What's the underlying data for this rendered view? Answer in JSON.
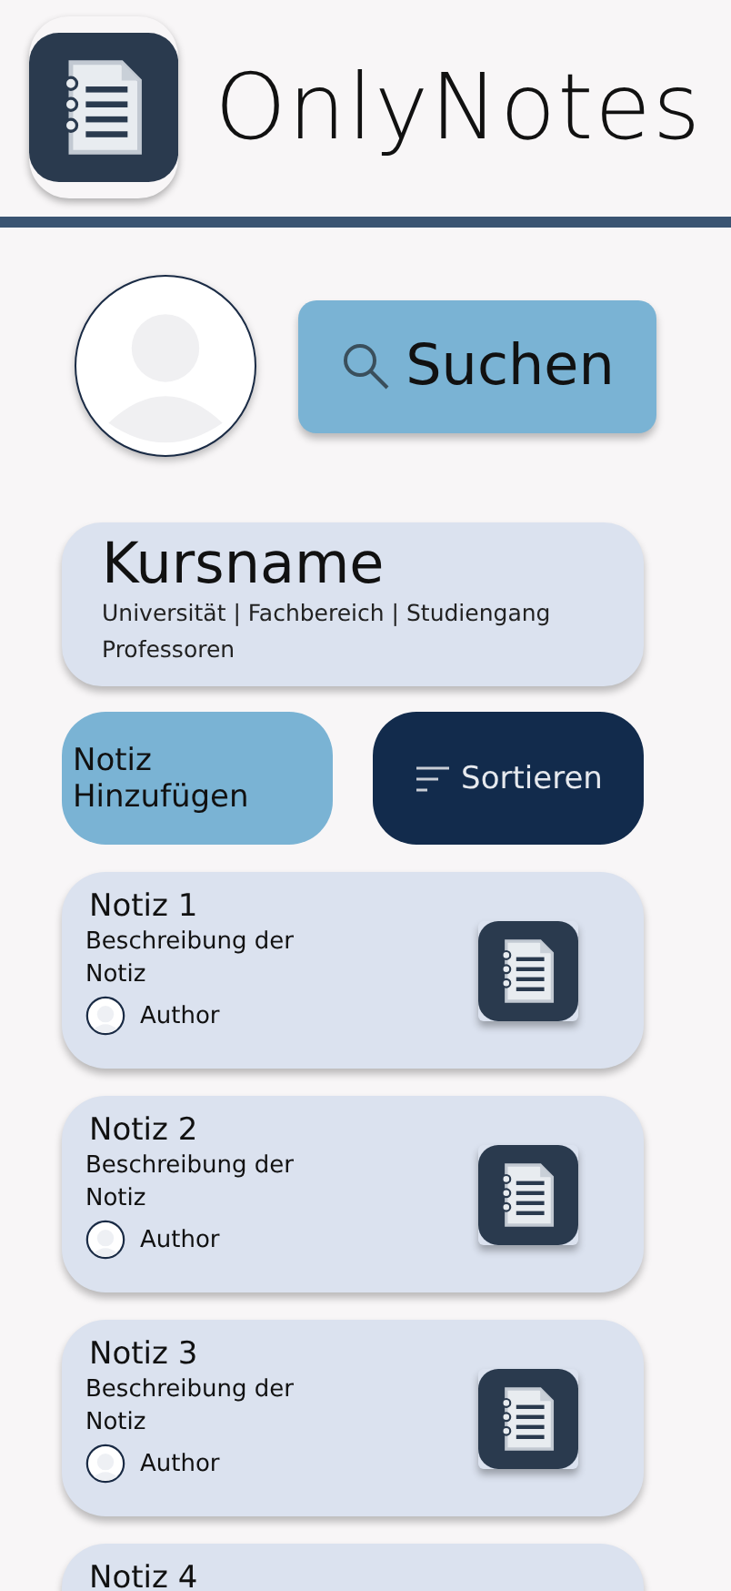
{
  "header": {
    "title": "OnlyNotes"
  },
  "search_button": {
    "label": "Suchen"
  },
  "course": {
    "name": "Kursname",
    "details": "Universität | Fachbereich | Studiengang",
    "professors": "Professoren"
  },
  "actions": [
    {
      "label": "Notiz Hinzufügen",
      "kind": "add"
    },
    {
      "label": "Sortieren",
      "kind": "sort"
    }
  ],
  "notes": [
    {
      "title": "Notiz 1",
      "description": "Beschreibung der Notiz",
      "author": "Author"
    },
    {
      "title": "Notiz 2",
      "description": "Beschreibung der Notiz",
      "author": "Author"
    },
    {
      "title": "Notiz 3",
      "description": "Beschreibung der Notiz",
      "author": "Author"
    },
    {
      "title": "Notiz 4"
    }
  ]
}
